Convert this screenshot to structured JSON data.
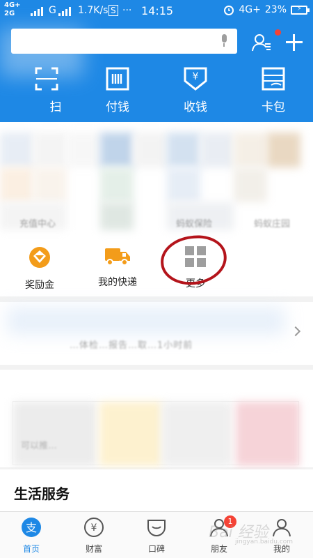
{
  "status_bar": {
    "net_top": "4G+",
    "net_bottom": "2G",
    "carrier2": "G",
    "speed": "1.7K/s",
    "dots": "···",
    "time": "14:15",
    "net_right": "4G+",
    "battery": "23%"
  },
  "header": {
    "search_placeholder": "",
    "quick_actions": [
      {
        "label": "扫",
        "icon": "scan-icon"
      },
      {
        "label": "付钱",
        "icon": "barcode-icon"
      },
      {
        "label": "收钱",
        "icon": "yuan-receipt-icon"
      },
      {
        "label": "卡包",
        "icon": "card-wallet-icon"
      }
    ]
  },
  "apps": {
    "row_labels": [
      "充值中心",
      "蚂蚁保险",
      "蚂蚁庄园"
    ],
    "items": [
      {
        "label": "奖励金",
        "icon": "reward-coin-icon"
      },
      {
        "label": "我的快递",
        "icon": "delivery-truck-icon"
      },
      {
        "label": "更多",
        "icon": "grid-more-icon"
      }
    ]
  },
  "news": {
    "text": "…体检…报告…取…1小时前"
  },
  "card": {
    "text": "可以推…"
  },
  "section": {
    "life_services": "生活服务"
  },
  "tabbar": {
    "tabs": [
      {
        "label": "首页",
        "icon": "alipay-home-icon",
        "active": true
      },
      {
        "label": "财富",
        "icon": "wealth-icon"
      },
      {
        "label": "口碑",
        "icon": "koubei-icon"
      },
      {
        "label": "朋友",
        "icon": "friends-icon",
        "badge": "1"
      },
      {
        "label": "我的",
        "icon": "profile-icon"
      }
    ]
  },
  "watermark": "Bai 经验",
  "watermark_sub": "jingyan.baidu.com",
  "colors": {
    "brand_blue": "#1e88e5",
    "accent_orange": "#f39c1a",
    "badge_red": "#f44336",
    "annotation_red": "#b4141b"
  }
}
